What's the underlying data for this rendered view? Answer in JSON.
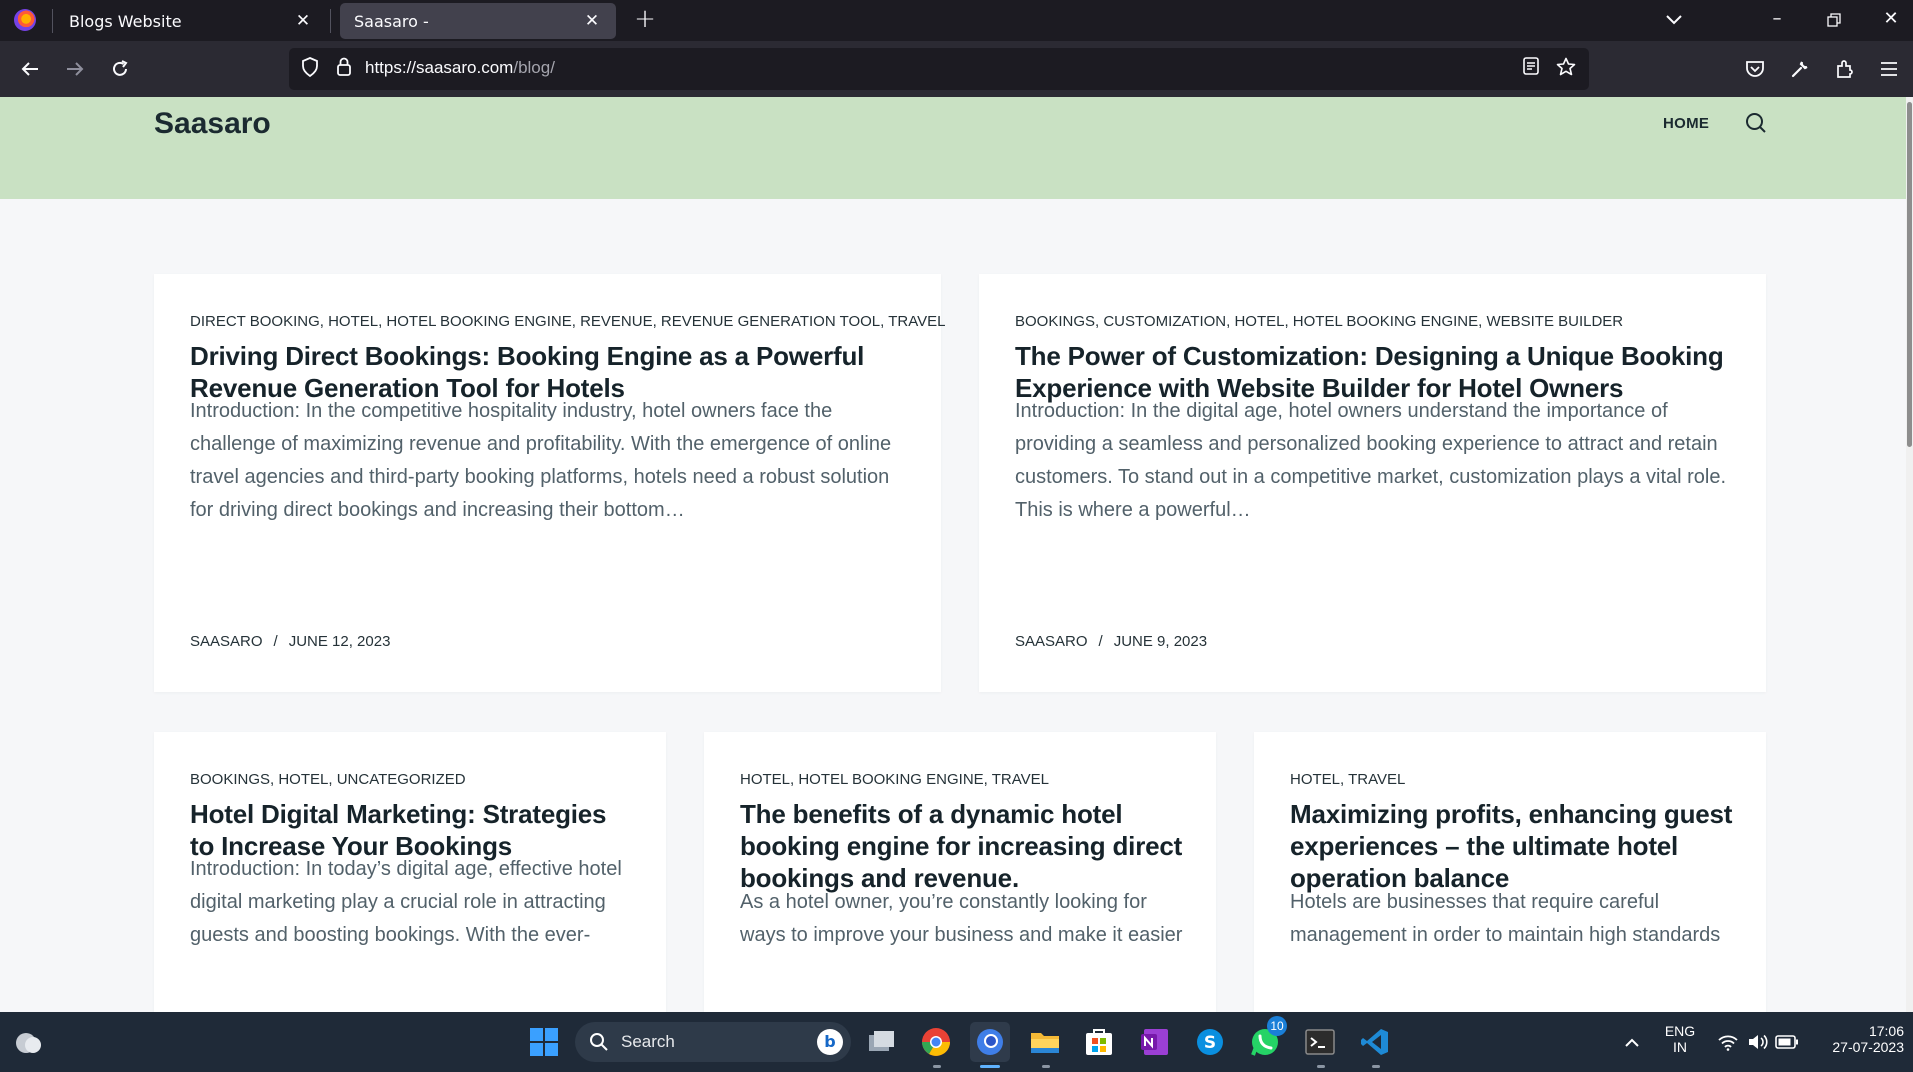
{
  "browser": {
    "tabs": [
      {
        "title": "Blogs Website",
        "active": false
      },
      {
        "title": "Saasaro -",
        "active": true
      }
    ],
    "url_host": "https://saasaro.com",
    "url_path": "/blog/"
  },
  "site": {
    "title": "Saasaro",
    "nav_home": "HOME"
  },
  "posts": [
    {
      "categories": "DIRECT BOOKING, HOTEL, HOTEL BOOKING ENGINE, REVENUE, REVENUE GENERATION TOOL, TRAVEL",
      "title_lines": [
        "Driving Direct Bookings: Booking Engine as a Powerful",
        "Revenue Generation Tool for Hotels"
      ],
      "excerpt_lines": [
        "Introduction: In the competitive hospitality industry, hotel owners face the",
        "challenge of maximizing revenue and profitability. With the emergence of online",
        "travel agencies and third-party booking platforms, hotels need a robust solution",
        "for driving direct bookings and increasing their bottom…"
      ],
      "author": "SAASARO",
      "date": "JUNE 12, 2023"
    },
    {
      "categories": "BOOKINGS, CUSTOMIZATION, HOTEL, HOTEL BOOKING ENGINE, WEBSITE BUILDER",
      "title_lines": [
        "The Power of Customization: Designing a Unique Booking",
        "Experience with Website Builder for Hotel Owners"
      ],
      "excerpt_lines": [
        "Introduction: In the digital age, hotel owners understand the importance of",
        "providing a seamless and personalized booking experience to attract and retain",
        "customers. To stand out in a competitive market, customization plays a vital role.",
        "This is where a powerful…"
      ],
      "author": "SAASARO",
      "date": "JUNE 9, 2023"
    },
    {
      "categories": "BOOKINGS, HOTEL, UNCATEGORIZED",
      "title_lines": [
        "Hotel Digital Marketing: Strategies",
        "to Increase Your Bookings"
      ],
      "excerpt_lines": [
        "Introduction: In today’s digital age, effective hotel",
        "digital marketing play a crucial role in attracting",
        "guests and boosting bookings. With the ever-"
      ]
    },
    {
      "categories": "HOTEL, HOTEL BOOKING ENGINE, TRAVEL",
      "title_lines": [
        "The benefits of a dynamic hotel",
        "booking engine for increasing direct",
        "bookings and revenue."
      ],
      "excerpt_lines": [
        "As a hotel owner, you’re constantly looking for",
        "ways to improve your business and make it easier"
      ]
    },
    {
      "categories": "HOTEL, TRAVEL",
      "title_lines": [
        "Maximizing profits, enhancing guest",
        "experiences – the ultimate hotel",
        "operation balance"
      ],
      "excerpt_lines": [
        "Hotels are businesses that require careful",
        "management in order to maintain high standards"
      ]
    }
  ],
  "taskbar": {
    "search_label": "Search",
    "whatsapp_badge": "10",
    "language": "ENG",
    "region": "IN",
    "time": "17:06",
    "date": "27-07-2023"
  },
  "colors": {
    "header_bg": "#c9e1c3",
    "tab_active_bg": "#42414d",
    "chrome_bg": "#1c1b22",
    "taskbar_bg": "#1f2a38"
  }
}
